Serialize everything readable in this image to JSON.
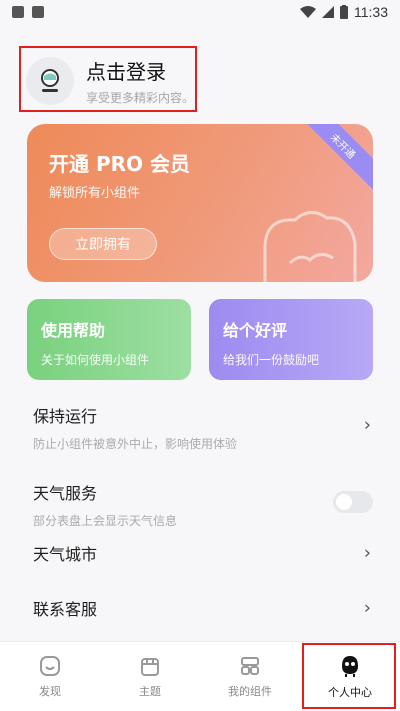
{
  "status": {
    "time": "11:33"
  },
  "login": {
    "title": "点击登录",
    "subtitle": "享受更多精彩内容。"
  },
  "pro": {
    "title": "开通 PRO 会员",
    "subtitle": "解锁所有小组件",
    "button": "立即拥有",
    "ribbon": "未开通"
  },
  "cards": {
    "help": {
      "title": "使用帮助",
      "subtitle": "关于如何使用小组件"
    },
    "rate": {
      "title": "给个好评",
      "subtitle": "给我们一份鼓励吧"
    }
  },
  "settings": {
    "keep_running": {
      "title": "保持运行",
      "subtitle": "防止小组件被意外中止，影响使用体验"
    },
    "weather_service": {
      "title": "天气服务",
      "subtitle": "部分表盘上会显示天气信息"
    },
    "weather_city": {
      "title": "天气城市"
    },
    "customer_service": {
      "title": "联系客服"
    }
  },
  "nav": {
    "discover": "发现",
    "theme": "主题",
    "widgets": "我的组件",
    "profile": "个人中心"
  },
  "colors": {
    "pro_gradient_start": "#ee8a58",
    "pro_gradient_end": "#f3a8a0",
    "help_green": "#79d17e",
    "rate_purple": "#9d8bf0",
    "highlight_red": "#e21f1f"
  },
  "icons": [
    "image-icon",
    "text-a-icon",
    "wifi-icon",
    "signal-icon",
    "battery-icon",
    "avatar-icon",
    "chevron-right-icon",
    "discover-icon",
    "theme-shop-icon",
    "widgets-grid-icon",
    "profile-face-icon"
  ]
}
